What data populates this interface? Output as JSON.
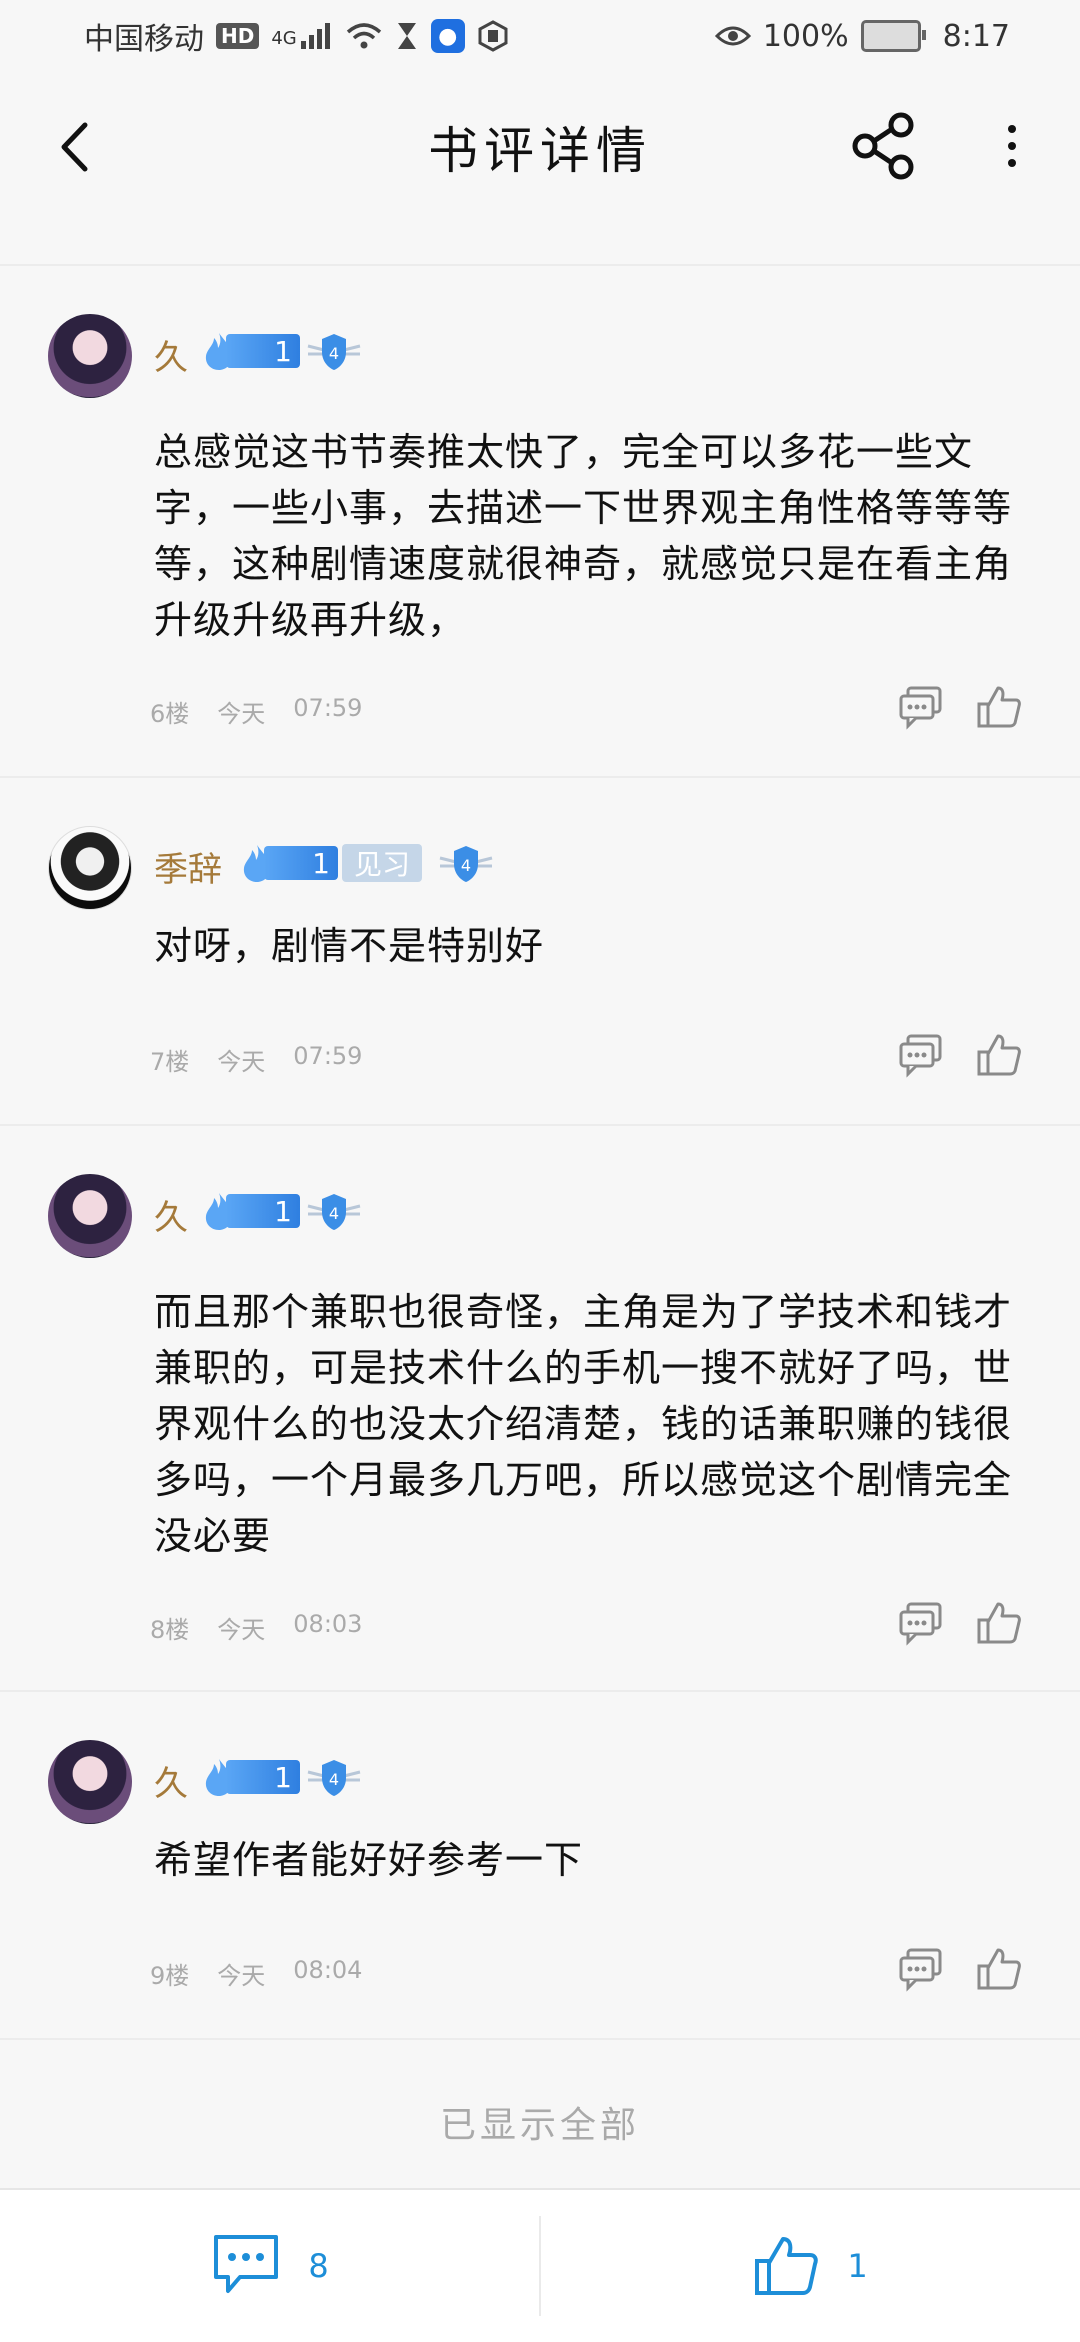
{
  "status": {
    "carrier": "中国移动",
    "hd": "HD",
    "network": "4G",
    "battery": "100%",
    "time": "8:17"
  },
  "header": {
    "title": "书评详情"
  },
  "comments": [
    {
      "user": "久",
      "level": "1",
      "tag": "",
      "text": "总感觉这书节奏推太快了，完全可以多花一些文字，一些小事，去描述一下世界观主角性格等等等等，这种剧情速度就很神奇，就感觉只是在看主角升级升级再升级，",
      "floor": "6楼",
      "day": "今天",
      "time": "07:59"
    },
    {
      "user": "季辞",
      "level": "1",
      "tag": "见习",
      "text": "对呀，剧情不是特别好",
      "floor": "7楼",
      "day": "今天",
      "time": "07:59"
    },
    {
      "user": "久",
      "level": "1",
      "tag": "",
      "text": "而且那个兼职也很奇怪，主角是为了学技术和钱才兼职的，可是技术什么的手机一搜不就好了吗，世界观什么的也没太介绍清楚，钱的话兼职赚的钱很多吗，一个月最多几万吧，所以感觉这个剧情完全没必要",
      "floor": "8楼",
      "day": "今天",
      "time": "08:03"
    },
    {
      "user": "久",
      "level": "1",
      "tag": "",
      "text": "希望作者能好好参考一下",
      "floor": "9楼",
      "day": "今天",
      "time": "08:04"
    }
  ],
  "footer": {
    "all_shown": "已显示全部"
  },
  "bottom_bar": {
    "comment_count": "8",
    "like_count": "1"
  },
  "badge_number": "4",
  "accent_color": "#1d8ed8"
}
